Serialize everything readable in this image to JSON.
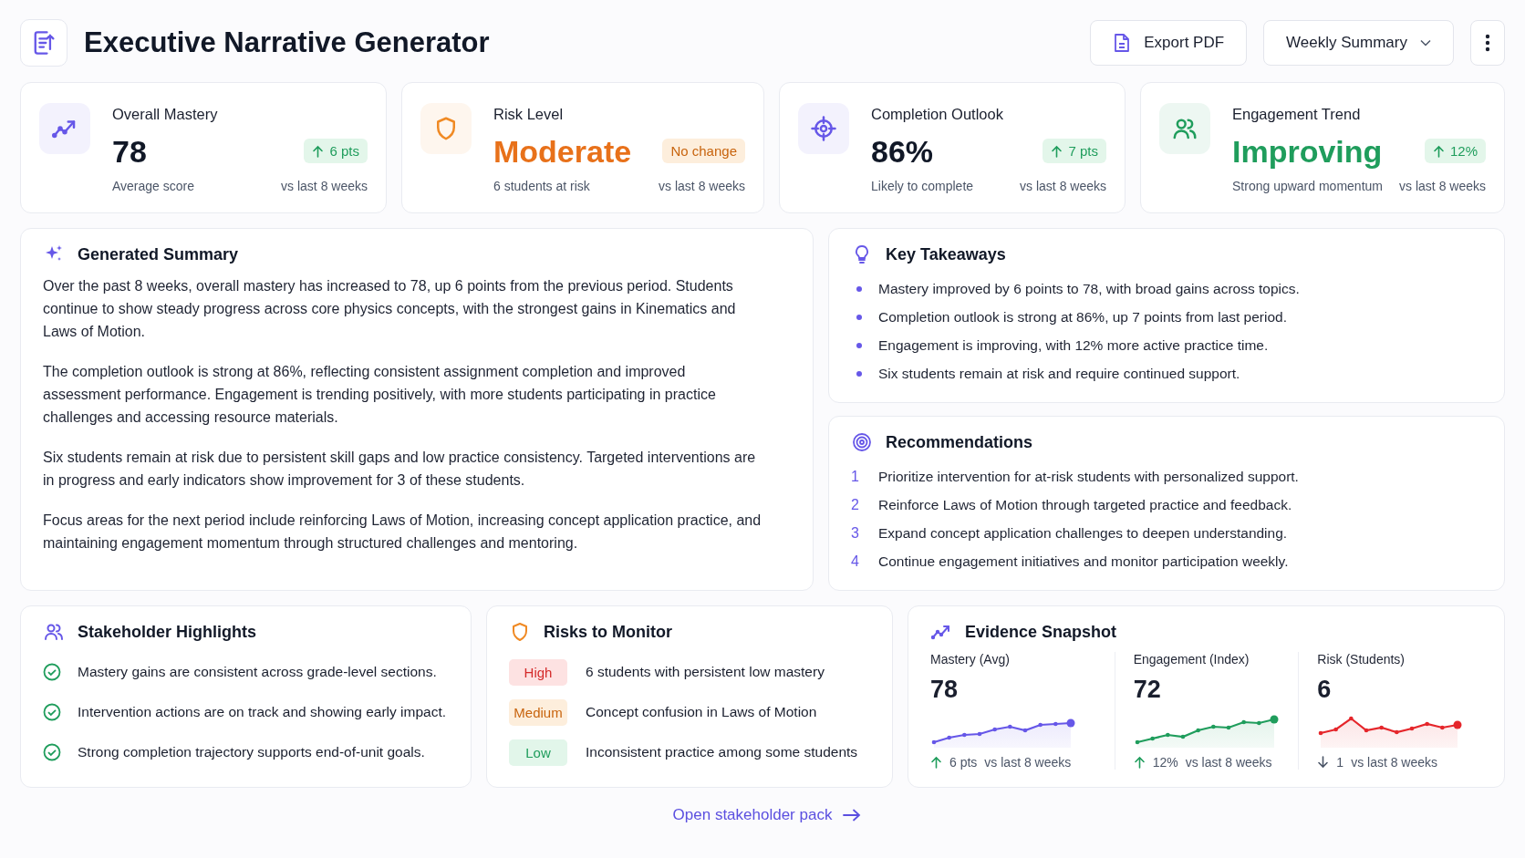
{
  "header": {
    "title": "Executive Narrative Generator",
    "export_button": "Export PDF",
    "period_select": "Weekly Summary"
  },
  "kpis": [
    {
      "kind": "mastery",
      "label": "Overall Mastery",
      "value": "78",
      "badge": {
        "text": "6 pts",
        "kind": "increase"
      },
      "caption": "Average score",
      "comparison": "vs last 8 weeks"
    },
    {
      "kind": "risk",
      "label": "Risk Level",
      "value": "Moderate",
      "badge": {
        "text": "No change",
        "kind": "neutral"
      },
      "caption": "6 students at risk",
      "comparison": "vs last 8 weeks"
    },
    {
      "kind": "completion",
      "label": "Completion Outlook",
      "value": "86%",
      "badge": {
        "text": "7 pts",
        "kind": "increase"
      },
      "caption": "Likely to complete",
      "comparison": "vs last 8 weeks"
    },
    {
      "kind": "engagement",
      "label": "Engagement Trend",
      "value": "Improving",
      "badge": {
        "text": "12%",
        "kind": "increase"
      },
      "caption": "Strong upward momentum",
      "comparison": "vs last 8 weeks"
    }
  ],
  "summary": {
    "title": "Generated Summary",
    "paragraphs": [
      "Over the past 8 weeks, overall mastery has increased to 78, up 6 points from the previous period. Students continue to show steady progress across core physics concepts, with the strongest gains in Kinematics and Laws of Motion.",
      "The completion outlook is strong at 86%, reflecting consistent assignment completion and improved assessment performance. Engagement is trending positively, with more students participating in practice challenges and accessing resource materials.",
      "Six students remain at risk due to persistent skill gaps and low practice consistency. Targeted interventions are in progress and early indicators show improvement for 3 of these students.",
      "Focus areas for the next period include reinforcing Laws of Motion, increasing concept application practice, and maintaining engagement momentum through structured challenges and mentoring."
    ]
  },
  "takeaways": {
    "title": "Key Takeaways",
    "items": [
      "Mastery improved by 6 points to 78, with broad gains across topics.",
      "Completion outlook is strong at 86%, up 7 points from last period.",
      "Engagement is improving, with 12% more active practice time.",
      "Six students remain at risk and require continued support."
    ]
  },
  "recommendations": {
    "title": "Recommendations",
    "items": [
      {
        "number": "1",
        "text": "Prioritize intervention for at-risk students with personalized support."
      },
      {
        "number": "2",
        "text": "Reinforce Laws of Motion through targeted practice and feedback."
      },
      {
        "number": "3",
        "text": "Expand concept application challenges to deepen understanding."
      },
      {
        "number": "4",
        "text": "Continue engagement initiatives and monitor participation weekly."
      }
    ]
  },
  "stakeholder_highlights": {
    "title": "Stakeholder Highlights",
    "items": [
      "Mastery gains are consistent across grade-level sections.",
      "Intervention actions are on track and showing early impact.",
      "Strong completion trajectory supports end-of-unit goals."
    ]
  },
  "risks": {
    "title": "Risks to Monitor",
    "items": [
      {
        "kind": "high",
        "label": "High",
        "text": "6 students with persistent low mastery"
      },
      {
        "kind": "medium",
        "label": "Medium",
        "text": "Concept confusion in Laws of Motion"
      },
      {
        "kind": "low",
        "label": "Low",
        "text": "Inconsistent practice among some students"
      }
    ]
  },
  "evidence": {
    "title": "Evidence Snapshot",
    "metrics": [
      {
        "label": "Mastery (Avg)",
        "value": "78",
        "color": "#6657e8",
        "kind": "increase",
        "change": "6 pts",
        "comparison": "vs last 8 weeks"
      },
      {
        "label": "Engagement (Index)",
        "value": "72",
        "color": "#1f9d5c",
        "kind": "increase",
        "change": "12%",
        "comparison": "vs last 8 weeks"
      },
      {
        "label": "Risk (Students)",
        "value": "6",
        "color": "#e5262b",
        "kind": "decrease",
        "change": "1",
        "comparison": "vs last 8 weeks"
      }
    ]
  },
  "footer_link": "Open stakeholder pack"
}
